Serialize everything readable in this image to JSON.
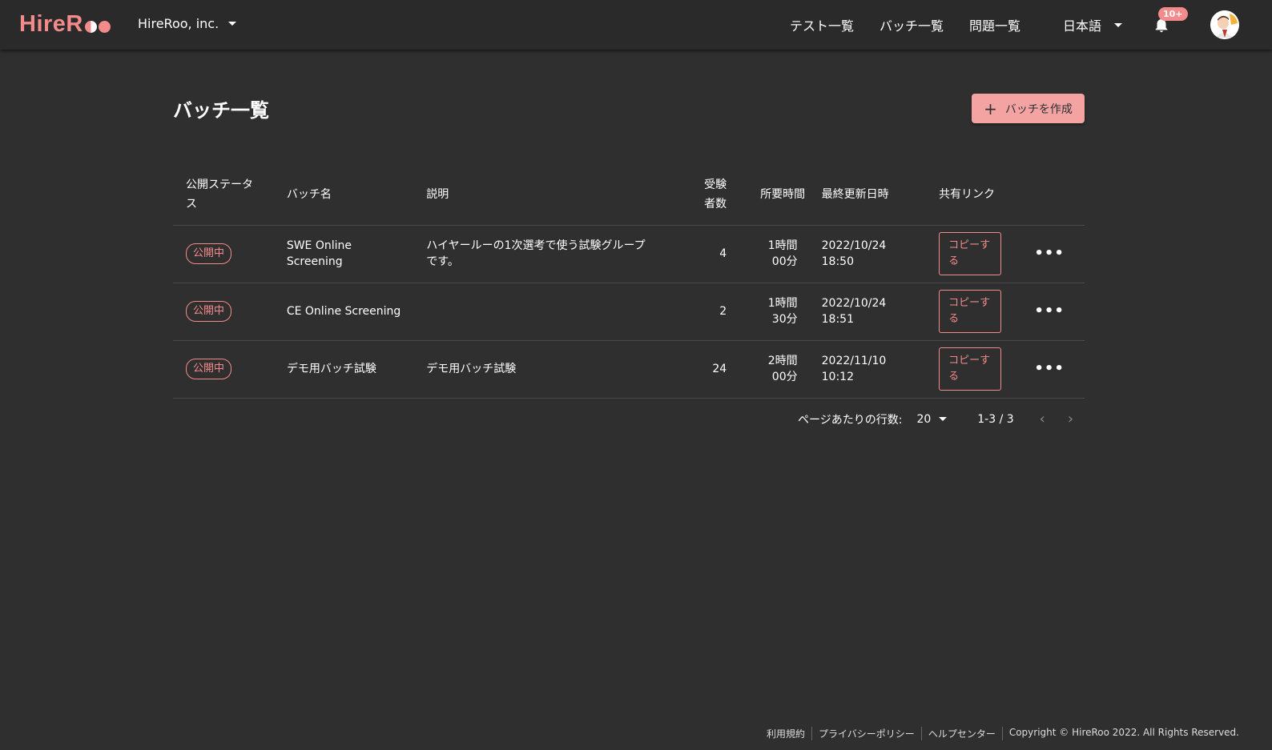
{
  "app": {
    "logo": "HireR",
    "org_name": "HireRoo, inc."
  },
  "nav": {
    "tests": "テスト一覧",
    "batches": "バッチ一覧",
    "questions": "問題一覧",
    "language": "日本語",
    "notification_badge": "10+"
  },
  "page": {
    "title": "バッチ一覧",
    "create_button": "バッチを作成"
  },
  "table": {
    "headers": {
      "status": "公開ステータス",
      "name": "バッチ名",
      "description": "説明",
      "candidates": "受験者数",
      "duration": "所要時間",
      "updated": "最終更新日時",
      "share": "共有リンク"
    },
    "rows": [
      {
        "status": "公開中",
        "name": "SWE Online Screening",
        "description": "ハイヤールーの1次選考で使う試験グループです。",
        "candidates": "4",
        "duration": "1時間 00分",
        "updated": "2022/10/24 18:50",
        "copy": "コピーする"
      },
      {
        "status": "公開中",
        "name": "CE Online Screening",
        "description": "",
        "candidates": "2",
        "duration": "1時間 30分",
        "updated": "2022/10/24 18:51",
        "copy": "コピーする"
      },
      {
        "status": "公開中",
        "name": "デモ用バッチ試験",
        "description": "デモ用バッチ試験",
        "candidates": "24",
        "duration": "2時間 00分",
        "updated": "2022/11/10 10:12",
        "copy": "コピーする"
      }
    ]
  },
  "pagination": {
    "rows_per_page_label": "ページあたりの行数:",
    "rows_per_page": "20",
    "range": "1-3 / 3"
  },
  "footer": {
    "terms": "利用規約",
    "privacy": "プライバシーポリシー",
    "help": "ヘルプセンター",
    "copyright": "Copyright © HireRoo 2022. All Rights Reserved."
  },
  "colors": {
    "accent": "#f48b8b",
    "background": "#2f2f2f",
    "appbar": "#2a2a2a"
  }
}
